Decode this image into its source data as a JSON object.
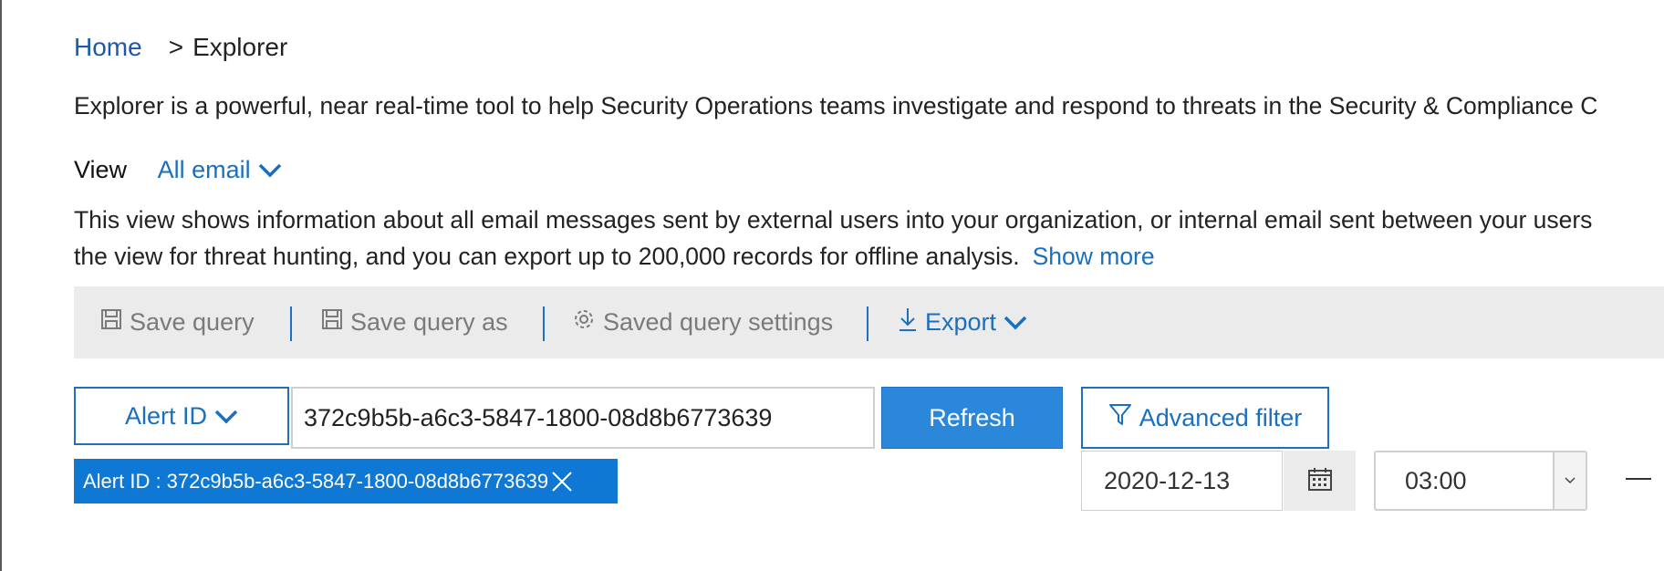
{
  "breadcrumb": {
    "home": "Home",
    "separator": ">",
    "current": "Explorer"
  },
  "description": "Explorer is a powerful, near real-time tool to help Security Operations teams investigate and respond to threats in the Security & Compliance C",
  "view": {
    "label": "View",
    "selected": "All email",
    "icon": "chevron-down-icon"
  },
  "info": {
    "line1": "This view shows information about all email messages sent by external users into your organization, or internal email sent between your users",
    "line2": "the view for threat hunting, and you can export up to 200,000 records for offline analysis.",
    "show_more": "Show more"
  },
  "toolbar": {
    "save_query": "Save query",
    "save_query_as": "Save query as",
    "saved_query_settings": "Saved query settings",
    "export": "Export"
  },
  "filter": {
    "field": "Alert ID",
    "value": "372c9b5b-a6c3-5847-1800-08d8b6773639",
    "refresh": "Refresh",
    "advanced": "Advanced filter"
  },
  "chip": {
    "label": "Alert ID : 372c9b5b-a6c3-5847-1800-08d8b6773639"
  },
  "date": {
    "value": "2020-12-13",
    "time": "03:00"
  },
  "colors": {
    "accent": "#1a6fbf",
    "button": "#2b87da",
    "chip": "#0f78d4",
    "toolbar_bg": "#ebebeb"
  }
}
